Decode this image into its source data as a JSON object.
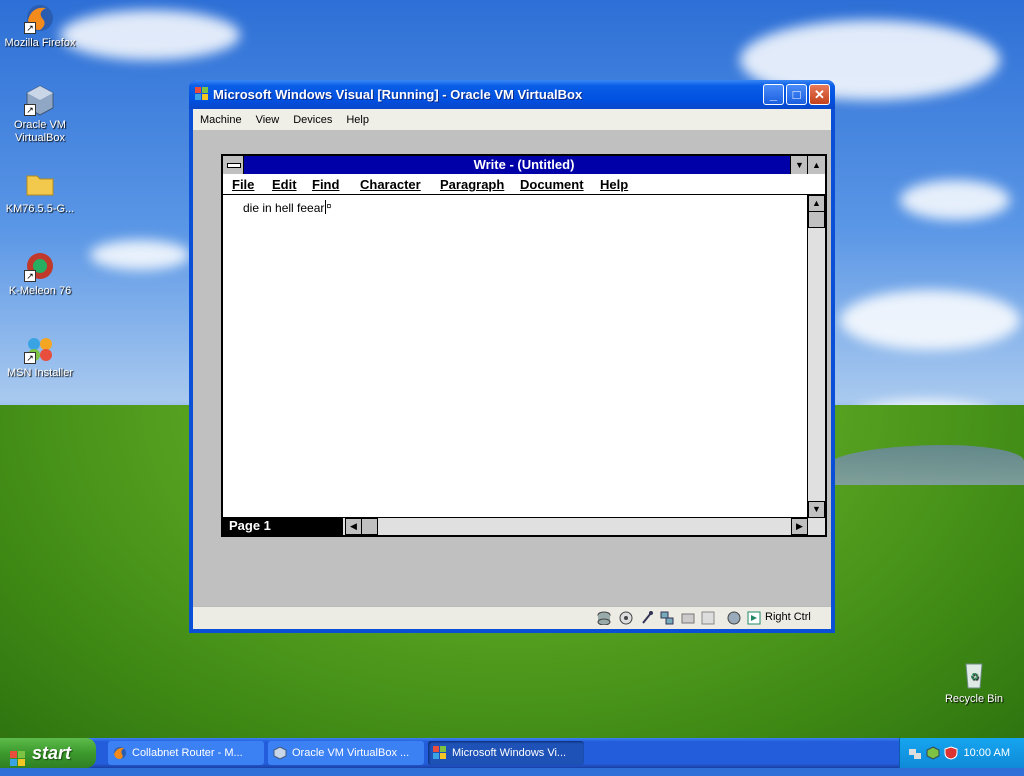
{
  "desktop": {
    "icons": [
      {
        "label": "Mozilla Firefox",
        "icon": "firefox-icon"
      },
      {
        "label": "Oracle VM VirtualBox",
        "icon": "virtualbox-icon"
      },
      {
        "label": "KM76.5.5-G...",
        "icon": "folder-icon"
      },
      {
        "label": "K-Meleon 76",
        "icon": "kmeleon-icon"
      },
      {
        "label": "MSN Installer",
        "icon": "msn-icon"
      },
      {
        "label": "Recycle Bin",
        "icon": "recycle-bin-icon"
      }
    ]
  },
  "vbox": {
    "title": "Microsoft Windows Visual [Running] - Oracle VM VirtualBox",
    "menu": [
      "Machine",
      "View",
      "Devices",
      "Help"
    ],
    "host_key": "Right Ctrl"
  },
  "write": {
    "title": "Write - (Untitled)",
    "menu": [
      "File",
      "Edit",
      "Find",
      "Character",
      "Paragraph",
      "Document",
      "Help"
    ],
    "content": "die in hell feear",
    "page_label": "Page 1"
  },
  "taskbar": {
    "start_label": "start",
    "tasks": [
      {
        "label": "Collabnet Router - M...",
        "icon": "firefox-icon"
      },
      {
        "label": "Oracle VM VirtualBox ...",
        "icon": "virtualbox-icon"
      },
      {
        "label": "Microsoft Windows Vi...",
        "icon": "windows-icon"
      }
    ],
    "clock": "10:00 AM"
  },
  "colors": {
    "write_title_bar": "#0000a8",
    "xp_title_blue": "#0050e0",
    "start_green": "#3c9a2d"
  }
}
